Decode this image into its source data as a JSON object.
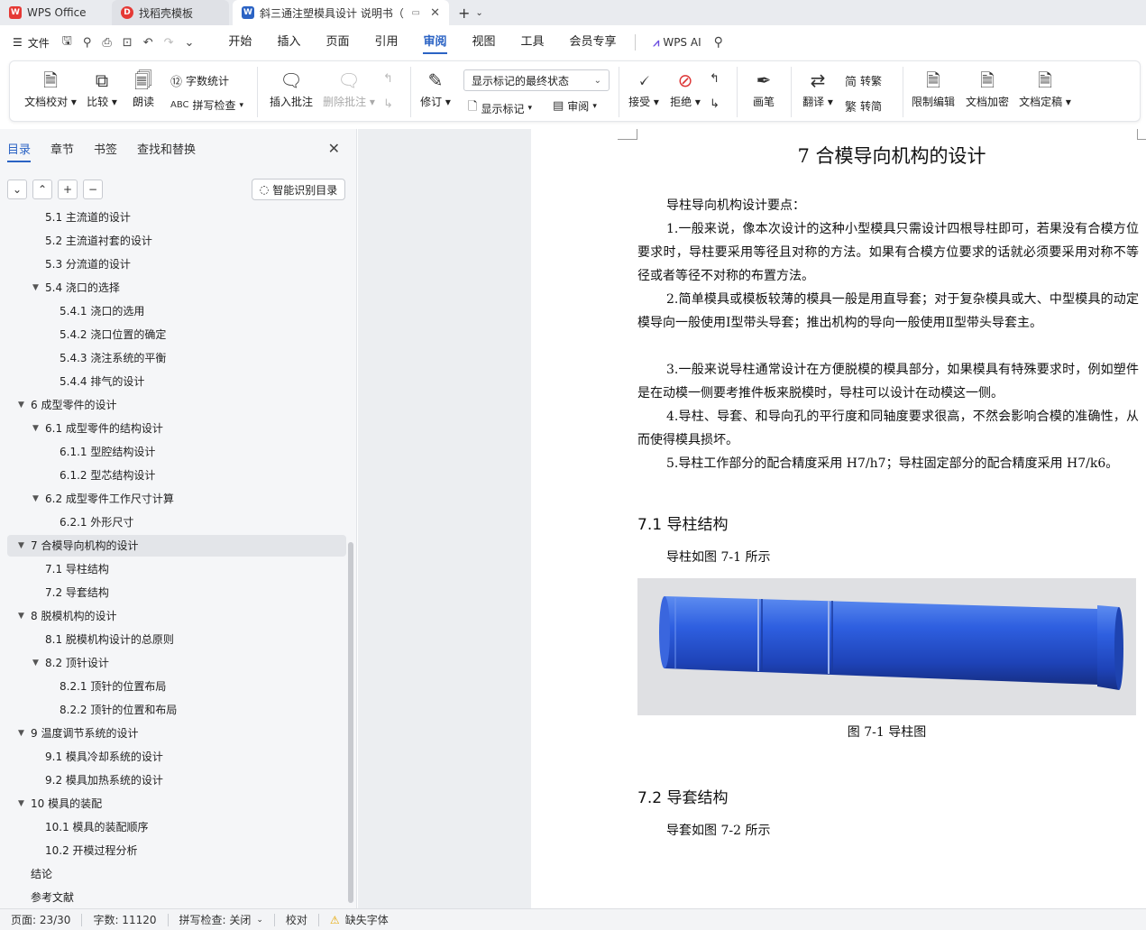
{
  "tabs": {
    "wps": "WPS Office",
    "template": "找稻壳模板",
    "document": "斜三通注塑模具设计 说明书（",
    "new_tab": "+"
  },
  "menu": {
    "file": "文件",
    "items": [
      "开始",
      "插入",
      "页面",
      "引用",
      "审阅",
      "视图",
      "工具",
      "会员专享"
    ],
    "active": "审阅",
    "wps_ai": "WPS AI"
  },
  "ribbon": {
    "proofread": "文档校对",
    "compare": "比较",
    "read_aloud": "朗读",
    "word_count": "字数统计",
    "spell_check": "拼写检查",
    "insert_comment": "插入批注",
    "delete_comment": "删除批注",
    "revise": "修订",
    "markup_state": "显示标记的最终状态",
    "show_markup": "显示标记",
    "review": "审阅",
    "accept": "接受",
    "reject": "拒绝",
    "pen": "画笔",
    "translate": "翻译",
    "to_traditional": "转繁",
    "to_simplified": "转简",
    "restrict_edit": "限制编辑",
    "encrypt": "文档加密",
    "finalize": "文档定稿"
  },
  "sidebar": {
    "tabs": [
      "目录",
      "章节",
      "书签",
      "查找和替换"
    ],
    "active_tab": "目录",
    "smart_toc": "智能识别目录",
    "toc": [
      {
        "label": "5.1  主流道的设计",
        "level": 2,
        "caret": false
      },
      {
        "label": "5.2  主流道衬套的设计",
        "level": 2,
        "caret": false
      },
      {
        "label": "5.3  分流道的设计",
        "level": 2,
        "caret": false
      },
      {
        "label": "5.4  浇口的选择",
        "level": 2,
        "caret": true
      },
      {
        "label": "5.4.1  浇口的选用",
        "level": 3,
        "caret": false
      },
      {
        "label": "5.4.2  浇口位置的确定",
        "level": 3,
        "caret": false
      },
      {
        "label": "5.4.3  浇注系统的平衡",
        "level": 3,
        "caret": false
      },
      {
        "label": "5.4.4  排气的设计",
        "level": 3,
        "caret": false
      },
      {
        "label": "6  成型零件的设计",
        "level": 1,
        "caret": true
      },
      {
        "label": "6.1  成型零件的结构设计",
        "level": 2,
        "caret": true
      },
      {
        "label": "6.1.1  型腔结构设计",
        "level": 3,
        "caret": false
      },
      {
        "label": "6.1.2  型芯结构设计",
        "level": 3,
        "caret": false
      },
      {
        "label": "6.2  成型零件工作尺寸计算",
        "level": 2,
        "caret": true
      },
      {
        "label": "6.2.1  外形尺寸",
        "level": 3,
        "caret": false
      },
      {
        "label": "7    合模导向机构的设计",
        "level": 1,
        "caret": true,
        "selected": true
      },
      {
        "label": "7.1  导柱结构",
        "level": 2,
        "caret": false
      },
      {
        "label": "7.2  导套结构",
        "level": 2,
        "caret": false
      },
      {
        "label": "8 脱模机构的设计",
        "level": 1,
        "caret": true
      },
      {
        "label": "8.1  脱模机构设计的总原则",
        "level": 2,
        "caret": false
      },
      {
        "label": "8.2  顶针设计",
        "level": 2,
        "caret": true
      },
      {
        "label": "8.2.1  顶针的位置布局",
        "level": 3,
        "caret": false
      },
      {
        "label": "8.2.2  顶针的位置和布局",
        "level": 3,
        "caret": false
      },
      {
        "label": "9  温度调节系统的设计",
        "level": 1,
        "caret": true
      },
      {
        "label": "9.1  模具冷却系统的设计",
        "level": 2,
        "caret": false
      },
      {
        "label": "9.2  模具加热系统的设计",
        "level": 2,
        "caret": false
      },
      {
        "label": "10  模具的装配",
        "level": 1,
        "caret": true
      },
      {
        "label": "10.1  模具的装配顺序",
        "level": 2,
        "caret": false
      },
      {
        "label": "10.2  开模过程分析",
        "level": 2,
        "caret": false
      },
      {
        "label": "结论",
        "level": 1,
        "caret": false
      },
      {
        "label": "参考文献",
        "level": 1,
        "caret": false
      }
    ]
  },
  "document": {
    "chapter_title": "7   合模导向机构的设计",
    "intro": "导柱导向机构设计要点：",
    "points": [
      "1.一般来说，像本次设计的这种小型模具只需设计四根导柱即可，若果没有合模方位要求时，导柱要采用等径且对称的方法。如果有合模方位要求的话就必须要采用对称不等径或者等径不对称的布置方法。",
      "2.简单模具或模板较薄的模具一般是用直导套；对于复杂模具或大、中型模具的动定模导向一般使用Ⅰ型带头导套；推出机构的导向一般使用Ⅱ型带头导套主。",
      "3.一般来说导柱通常设计在方便脱模的模具部分，如果模具有特殊要求时，例如塑件是在动模一侧要考推件板来脱模时，导柱可以设计在动模这一侧。",
      "4.导柱、导套、和导向孔的平行度和同轴度要求很高，不然会影响合模的准确性，从而使得模具损坏。",
      "5.导柱工作部分的配合精度采用 H7/h7；导柱固定部分的配合精度采用 H7/k6。"
    ],
    "section1_title": "7.1  导柱结构",
    "section1_text": "导柱如图 7-1 所示",
    "figure_caption": "图 7-1   导柱图",
    "section2_title": "7.2  导套结构",
    "section2_text": "导套如图 7-2 所示"
  },
  "status": {
    "page": "页面: 23/30",
    "words": "字数: 11120",
    "spell": "拼写检查: 关闭",
    "proof": "校对",
    "missing_font": "缺失字体"
  }
}
